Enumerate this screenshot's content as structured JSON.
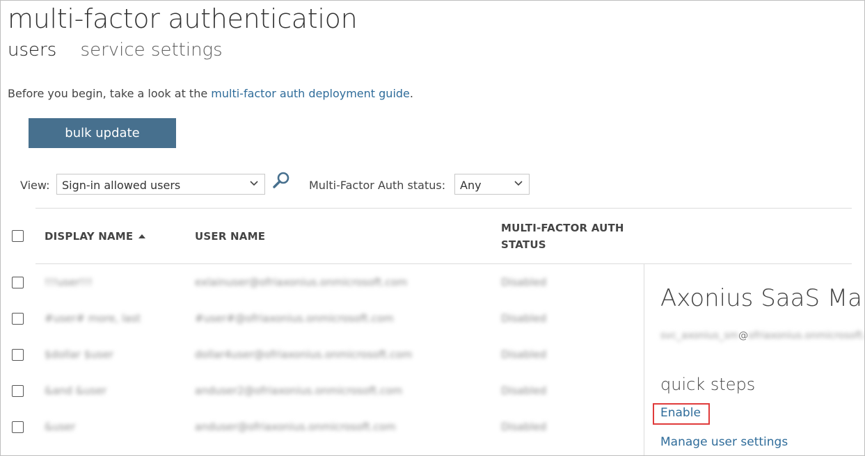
{
  "page": {
    "title": "multi-factor authentication",
    "tabs": [
      {
        "label": "users",
        "active": true
      },
      {
        "label": "service settings",
        "active": false
      }
    ]
  },
  "intro": {
    "text": "Before you begin, take a look at the ",
    "link": "multi-factor auth deployment guide",
    "suffix": "."
  },
  "toolbar": {
    "bulk_update_label": "bulk update"
  },
  "filters": {
    "view_label": "View:",
    "view_value": "Sign-in allowed users",
    "mfa_label": "Multi-Factor Auth status:",
    "mfa_value": "Any"
  },
  "table": {
    "headers": {
      "display_name": "DISPLAY NAME",
      "user_name": "USER NAME",
      "mfa_status": "MULTI-FACTOR AUTH STATUS"
    },
    "rows": [
      {
        "display_name": "!!!user!!!",
        "user_name": "exlainuser@ofriaxonius.onmicrosoft.com",
        "status": "Disabled"
      },
      {
        "display_name": "#user# more, last",
        "user_name": "#user#@ofriaxonius.onmicrosoft.com",
        "status": "Disabled"
      },
      {
        "display_name": "$dollar $user",
        "user_name": "dollar4user@ofriaxonius.onmicrosoft.com",
        "status": "Disabled"
      },
      {
        "display_name": "&and &user",
        "user_name": "anduser2@ofriaxonius.onmicrosoft.com",
        "status": "Disabled"
      },
      {
        "display_name": "&user",
        "user_name": "anduser@ofriaxonius.onmicrosoft.com",
        "status": "Disabled"
      }
    ]
  },
  "detail_panel": {
    "title": "Axonius SaaS Ma",
    "email_local": "svc_axonius_sm",
    "email_at": "@",
    "email_domain": "ofriaxonius.onmicrosoft.com",
    "quick_steps_title": "quick steps",
    "enable_label": "Enable",
    "manage_label": "Manage user settings"
  },
  "colors": {
    "accent_button": "#47708e",
    "link": "#2f6c9a",
    "highlight_box": "#e03b3b"
  }
}
